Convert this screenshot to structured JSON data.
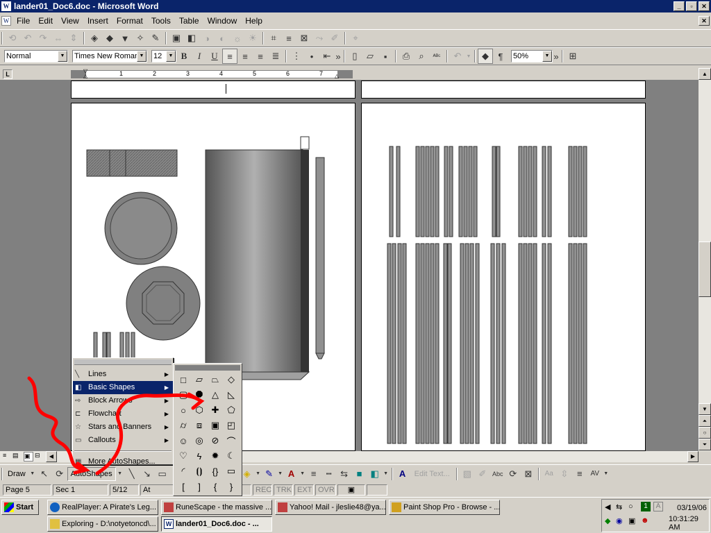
{
  "window": {
    "title": "lander01_Doc6.doc - Microsoft Word",
    "icon_label": "W",
    "minimize_label": "_",
    "maximize_label": "▫",
    "close_label": "✕"
  },
  "menu": [
    "File",
    "Edit",
    "View",
    "Insert",
    "Format",
    "Tools",
    "Table",
    "Window",
    "Help"
  ],
  "formatting": {
    "style": "Normal",
    "font": "Times New Roman",
    "size": "12",
    "zoom": "50%",
    "bold": "B",
    "italic": "I",
    "underline": "U",
    "pilcrow": "¶"
  },
  "ruler_numbers": [
    "1",
    "2",
    "3",
    "4",
    "5",
    "6",
    "7"
  ],
  "ruler_tab_label": "L",
  "autoshapes_menu": {
    "items": [
      {
        "label": "Lines",
        "has_sub": true,
        "selected": false
      },
      {
        "label": "Basic Shapes",
        "has_sub": true,
        "selected": true
      },
      {
        "label": "Block Arrows",
        "has_sub": true,
        "selected": false
      },
      {
        "label": "Flowchart",
        "has_sub": true,
        "selected": false
      },
      {
        "label": "Stars and Banners",
        "has_sub": true,
        "selected": false
      },
      {
        "label": "Callouts",
        "has_sub": true,
        "selected": false
      }
    ],
    "more": "More AutoShapes..."
  },
  "drawing_toolbar": {
    "draw": "Draw",
    "autoshapes": "AutoShapes",
    "edit_text": "Edit Text...",
    "abc": "Abc",
    "aa": "Aa",
    "av": "AV"
  },
  "status": {
    "page": "Page 5",
    "sec": "Sec 1",
    "pages": "5/12",
    "at": "At",
    "rec": "REC",
    "trk": "TRK",
    "ext": "EXT",
    "ovr": "OVR"
  },
  "taskbar": {
    "start": "Start",
    "buttons": [
      "RealPlayer: A Pirate's Leg...",
      "RuneScape - the massive ...",
      "Yahoo! Mail - jleslie48@ya...",
      "Paint Shop Pro - Browse - ...",
      "Exploring - D:\\notyetoncd\\...",
      "lander01_Doc6.doc - ..."
    ],
    "date": "03/19/06",
    "time": "10:31:29 AM",
    "tray_number": "1",
    "tray_letter": "A"
  },
  "colors": {
    "titlebar": "#0a246a",
    "face": "#d4d0c8",
    "annotation": "#ff0000",
    "doc_bg": "#808080"
  }
}
